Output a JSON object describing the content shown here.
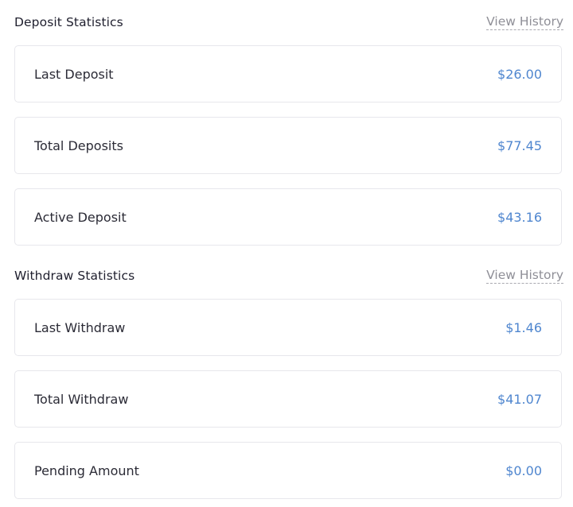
{
  "deposit": {
    "title": "Deposit Statistics",
    "history_link": "View History",
    "items": [
      {
        "label": "Last Deposit",
        "value": "$26.00"
      },
      {
        "label": "Total Deposits",
        "value": "$77.45"
      },
      {
        "label": "Active Deposit",
        "value": "$43.16"
      }
    ]
  },
  "withdraw": {
    "title": "Withdraw Statistics",
    "history_link": "View History",
    "items": [
      {
        "label": "Last Withdraw",
        "value": "$1.46"
      },
      {
        "label": "Total Withdraw",
        "value": "$41.07"
      },
      {
        "label": "Pending Amount",
        "value": "$0.00"
      }
    ]
  },
  "colors": {
    "value_accent": "#4f86cf",
    "link_gray": "#8f8f97",
    "card_border": "#e7e7ec"
  }
}
